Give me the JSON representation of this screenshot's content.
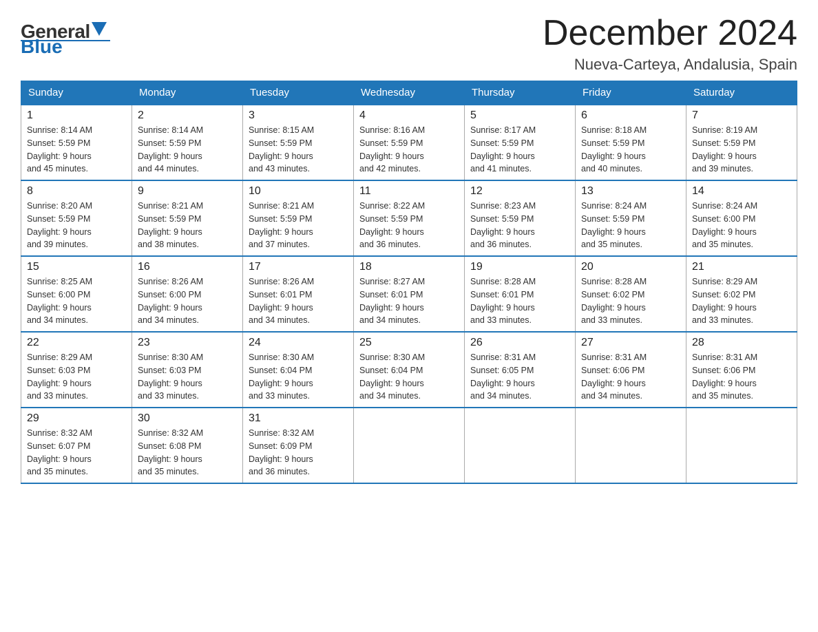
{
  "logo": {
    "general": "General",
    "blue": "Blue"
  },
  "title": {
    "month": "December 2024",
    "location": "Nueva-Carteya, Andalusia, Spain"
  },
  "days": [
    "Sunday",
    "Monday",
    "Tuesday",
    "Wednesday",
    "Thursday",
    "Friday",
    "Saturday"
  ],
  "weeks": [
    [
      {
        "day": "1",
        "sunrise": "8:14 AM",
        "sunset": "5:59 PM",
        "daylight": "9 hours and 45 minutes."
      },
      {
        "day": "2",
        "sunrise": "8:14 AM",
        "sunset": "5:59 PM",
        "daylight": "9 hours and 44 minutes."
      },
      {
        "day": "3",
        "sunrise": "8:15 AM",
        "sunset": "5:59 PM",
        "daylight": "9 hours and 43 minutes."
      },
      {
        "day": "4",
        "sunrise": "8:16 AM",
        "sunset": "5:59 PM",
        "daylight": "9 hours and 42 minutes."
      },
      {
        "day": "5",
        "sunrise": "8:17 AM",
        "sunset": "5:59 PM",
        "daylight": "9 hours and 41 minutes."
      },
      {
        "day": "6",
        "sunrise": "8:18 AM",
        "sunset": "5:59 PM",
        "daylight": "9 hours and 40 minutes."
      },
      {
        "day": "7",
        "sunrise": "8:19 AM",
        "sunset": "5:59 PM",
        "daylight": "9 hours and 39 minutes."
      }
    ],
    [
      {
        "day": "8",
        "sunrise": "8:20 AM",
        "sunset": "5:59 PM",
        "daylight": "9 hours and 39 minutes."
      },
      {
        "day": "9",
        "sunrise": "8:21 AM",
        "sunset": "5:59 PM",
        "daylight": "9 hours and 38 minutes."
      },
      {
        "day": "10",
        "sunrise": "8:21 AM",
        "sunset": "5:59 PM",
        "daylight": "9 hours and 37 minutes."
      },
      {
        "day": "11",
        "sunrise": "8:22 AM",
        "sunset": "5:59 PM",
        "daylight": "9 hours and 36 minutes."
      },
      {
        "day": "12",
        "sunrise": "8:23 AM",
        "sunset": "5:59 PM",
        "daylight": "9 hours and 36 minutes."
      },
      {
        "day": "13",
        "sunrise": "8:24 AM",
        "sunset": "5:59 PM",
        "daylight": "9 hours and 35 minutes."
      },
      {
        "day": "14",
        "sunrise": "8:24 AM",
        "sunset": "6:00 PM",
        "daylight": "9 hours and 35 minutes."
      }
    ],
    [
      {
        "day": "15",
        "sunrise": "8:25 AM",
        "sunset": "6:00 PM",
        "daylight": "9 hours and 34 minutes."
      },
      {
        "day": "16",
        "sunrise": "8:26 AM",
        "sunset": "6:00 PM",
        "daylight": "9 hours and 34 minutes."
      },
      {
        "day": "17",
        "sunrise": "8:26 AM",
        "sunset": "6:01 PM",
        "daylight": "9 hours and 34 minutes."
      },
      {
        "day": "18",
        "sunrise": "8:27 AM",
        "sunset": "6:01 PM",
        "daylight": "9 hours and 34 minutes."
      },
      {
        "day": "19",
        "sunrise": "8:28 AM",
        "sunset": "6:01 PM",
        "daylight": "9 hours and 33 minutes."
      },
      {
        "day": "20",
        "sunrise": "8:28 AM",
        "sunset": "6:02 PM",
        "daylight": "9 hours and 33 minutes."
      },
      {
        "day": "21",
        "sunrise": "8:29 AM",
        "sunset": "6:02 PM",
        "daylight": "9 hours and 33 minutes."
      }
    ],
    [
      {
        "day": "22",
        "sunrise": "8:29 AM",
        "sunset": "6:03 PM",
        "daylight": "9 hours and 33 minutes."
      },
      {
        "day": "23",
        "sunrise": "8:30 AM",
        "sunset": "6:03 PM",
        "daylight": "9 hours and 33 minutes."
      },
      {
        "day": "24",
        "sunrise": "8:30 AM",
        "sunset": "6:04 PM",
        "daylight": "9 hours and 33 minutes."
      },
      {
        "day": "25",
        "sunrise": "8:30 AM",
        "sunset": "6:04 PM",
        "daylight": "9 hours and 34 minutes."
      },
      {
        "day": "26",
        "sunrise": "8:31 AM",
        "sunset": "6:05 PM",
        "daylight": "9 hours and 34 minutes."
      },
      {
        "day": "27",
        "sunrise": "8:31 AM",
        "sunset": "6:06 PM",
        "daylight": "9 hours and 34 minutes."
      },
      {
        "day": "28",
        "sunrise": "8:31 AM",
        "sunset": "6:06 PM",
        "daylight": "9 hours and 35 minutes."
      }
    ],
    [
      {
        "day": "29",
        "sunrise": "8:32 AM",
        "sunset": "6:07 PM",
        "daylight": "9 hours and 35 minutes."
      },
      {
        "day": "30",
        "sunrise": "8:32 AM",
        "sunset": "6:08 PM",
        "daylight": "9 hours and 35 minutes."
      },
      {
        "day": "31",
        "sunrise": "8:32 AM",
        "sunset": "6:09 PM",
        "daylight": "9 hours and 36 minutes."
      },
      null,
      null,
      null,
      null
    ]
  ],
  "labels": {
    "sunrise": "Sunrise:",
    "sunset": "Sunset:",
    "daylight": "Daylight:"
  }
}
